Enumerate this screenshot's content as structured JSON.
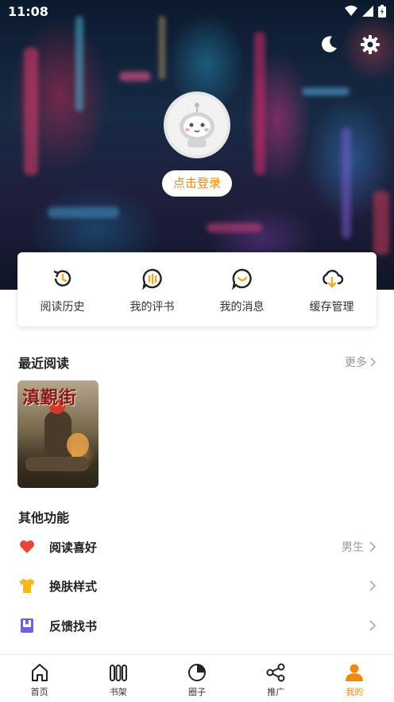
{
  "status_bar": {
    "time": "11:08"
  },
  "profile": {
    "login_label": "点击登录"
  },
  "quick_actions": [
    {
      "label": "阅读历史",
      "icon": "history-icon"
    },
    {
      "label": "我的评书",
      "icon": "comment-icon"
    },
    {
      "label": "我的消息",
      "icon": "message-icon"
    },
    {
      "label": "缓存管理",
      "icon": "cloud-download-icon"
    }
  ],
  "recent_reading": {
    "title": "最近阅读",
    "more_label": "更多",
    "books": [
      {
        "cover_title": "滇覲街"
      }
    ]
  },
  "other_functions": {
    "title": "其他功能",
    "items": [
      {
        "label": "阅读喜好",
        "value": "男生",
        "icon": "heart-icon",
        "icon_color": "#e8443a"
      },
      {
        "label": "换肤样式",
        "value": "",
        "icon": "tshirt-icon",
        "icon_color": "#f5b81c"
      },
      {
        "label": "反馈找书",
        "value": "",
        "icon": "book-icon",
        "icon_color": "#6f63d9"
      }
    ]
  },
  "bottom_nav": {
    "items": [
      {
        "label": "首页",
        "icon": "home-icon"
      },
      {
        "label": "书架",
        "icon": "bookshelf-icon"
      },
      {
        "label": "圈子",
        "icon": "circle-icon"
      },
      {
        "label": "推广",
        "icon": "share-icon"
      },
      {
        "label": "我的",
        "icon": "user-icon",
        "active": true
      }
    ]
  },
  "colors": {
    "accent": "#ee8a12",
    "text": "#222222",
    "muted": "#999999"
  }
}
